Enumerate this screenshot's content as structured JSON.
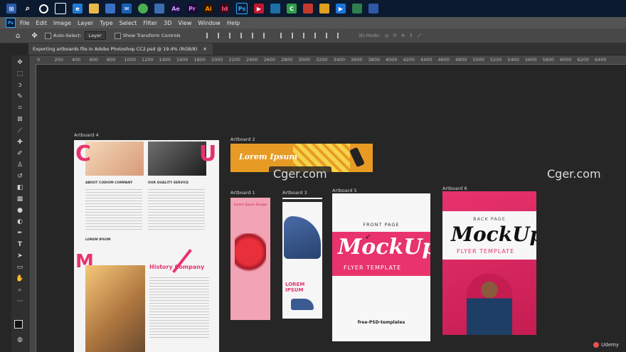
{
  "menu": [
    "File",
    "Edit",
    "Image",
    "Layer",
    "Type",
    "Select",
    "Filter",
    "3D",
    "View",
    "Window",
    "Help"
  ],
  "options": {
    "auto_select_label": "Auto-Select:",
    "layer_dropdown": "Layer",
    "transform_label": "Show Transform Controls",
    "mode_3d": "3D Mode:"
  },
  "document": {
    "tab_title": "Exporting artboards file in Adobe Photoshop CC2.psd @ 19.4% (RGB/8)"
  },
  "ruler_ticks": [
    "0",
    "200",
    "400",
    "600",
    "800",
    "1000",
    "1200",
    "1400",
    "1600",
    "1800",
    "2000",
    "2200",
    "2400",
    "2600",
    "2800",
    "3000",
    "3200",
    "3400",
    "3600",
    "3800",
    "4000",
    "4200",
    "4400",
    "4600",
    "4800",
    "5000",
    "5200",
    "5400",
    "5600",
    "5800",
    "6000",
    "6200",
    "6400"
  ],
  "artboards": {
    "ab4": {
      "label": "Artboard 4",
      "letters": [
        "C",
        "U",
        "M"
      ],
      "heading1": "ABOUT CODIUM COMPANY",
      "heading2": "OUR QUALITY SERVICE",
      "heading3": "LOREM IPSUM",
      "history": "History Company"
    },
    "ab2": {
      "label": "Artboard 2",
      "text": "Lorem Ipsum"
    },
    "ab1": {
      "label": "Artboard 1",
      "text": "Lorem Ipsum Design"
    },
    "ab3": {
      "label": "Artboard 3",
      "text": "LOREM IPSUM"
    },
    "ab5": {
      "label": "Artboard 5",
      "page": "FRONT PAGE",
      "title": "MockUp",
      "subtitle": "FLYER TEMPLATE",
      "brand": "free-PSD-templates"
    },
    "ab6": {
      "label": "Artboard 6",
      "page": "BACK PAGE",
      "title": "MockUp",
      "subtitle": "FLYER TEMPLATE"
    }
  },
  "watermarks": [
    "Cger.com",
    "Cger.com"
  ],
  "badge": "Udemy",
  "colors": {
    "pink": "#e8336d",
    "dark": "#262626",
    "panel": "#535353",
    "accent": "#31a8ff"
  }
}
